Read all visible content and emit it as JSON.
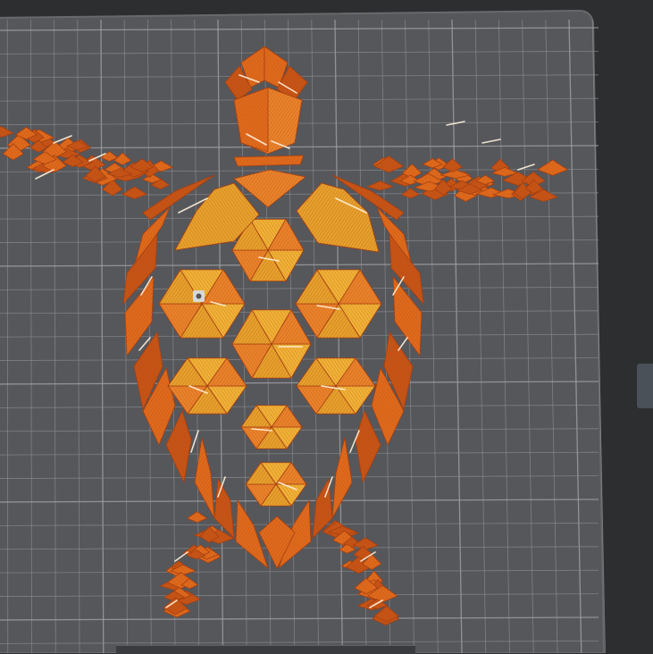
{
  "scene": {
    "background_color": "#2d2e30",
    "bed_color": "#56575b",
    "bed_edge_color": "#68696d",
    "grid_color": "#8c8e92",
    "grid_major_color": "#a4a6aa",
    "grid_minor_step": 1,
    "grid_major_every": 5
  },
  "model": {
    "icon": "sea-turtle-model-icon",
    "colors": {
      "shell_gold": "#e6a12c",
      "shell_amber": "#f0b236",
      "shell_orange": "#e9822a",
      "edge_orange": "#df6a1c",
      "dark_orange": "#c65416",
      "stripe_dark": "#a63f10",
      "highlight": "#fff2dc"
    }
  },
  "seam_marker": {
    "icon": "seam-marker-icon",
    "color": "#d8d8d8"
  },
  "side_panel_tab": {
    "icon": "panel-collapse-icon",
    "color": "#4a5158"
  }
}
